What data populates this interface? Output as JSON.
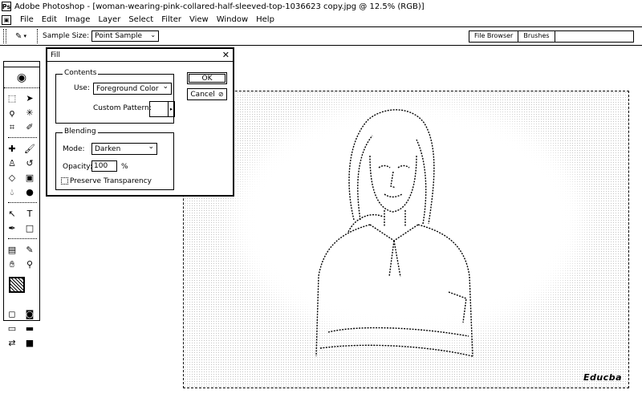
{
  "app": {
    "title": "Adobe Photoshop - [woman-wearing-pink-collared-half-sleeved-top-1036623 copy.jpg @ 12.5% (RGB)]"
  },
  "menu": {
    "items": [
      {
        "label": "File"
      },
      {
        "label": "Edit"
      },
      {
        "label": "Image"
      },
      {
        "label": "Layer"
      },
      {
        "label": "Select"
      },
      {
        "label": "Filter"
      },
      {
        "label": "View"
      },
      {
        "label": "Window"
      },
      {
        "label": "Help"
      }
    ]
  },
  "options_bar": {
    "sample_size_label": "Sample Size:",
    "sample_size_value": "Point Sample",
    "palette_tabs": [
      "File Browser",
      "Brushes"
    ]
  },
  "toolbox": {
    "tools": [
      "marquee-tool",
      "move-tool",
      "lasso-tool",
      "magic-wand-tool",
      "crop-tool",
      "slice-tool",
      "healing-brush-tool",
      "brush-tool",
      "clone-stamp-tool",
      "history-brush-tool",
      "eraser-tool",
      "gradient-tool",
      "blur-tool",
      "burn-tool",
      "path-selection-tool",
      "type-tool",
      "pen-tool",
      "shape-tool",
      "notes-tool",
      "eyedropper-tool",
      "hand-tool",
      "zoom-tool"
    ]
  },
  "document": {
    "watermark": "Educba"
  },
  "fill_dialog": {
    "title": "Fill",
    "contents": {
      "legend": "Contents",
      "use_label": "Use:",
      "use_value": "Foreground Color",
      "custom_pattern_label": "Custom Pattern:"
    },
    "blending": {
      "legend": "Blending",
      "mode_label": "Mode:",
      "mode_value": "Darken",
      "opacity_label": "Opacity:",
      "opacity_value": "100",
      "opacity_unit": "%",
      "preserve_transparency_label": "Preserve Transparency",
      "preserve_transparency_checked": false
    },
    "ok_label": "OK",
    "cancel_label": "Cancel"
  }
}
